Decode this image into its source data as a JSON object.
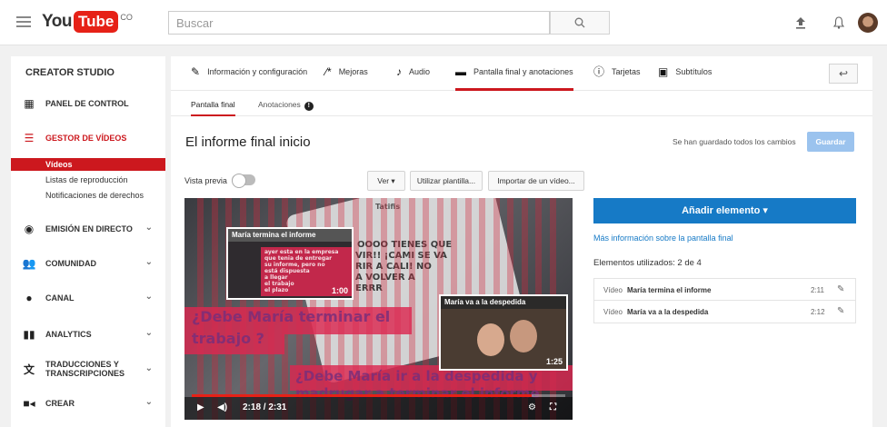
{
  "topbar": {
    "logo_you": "You",
    "logo_tube": "Tube",
    "logo_suffix": "CO",
    "search_placeholder": "Buscar"
  },
  "sidebar": {
    "title": "CREATOR STUDIO",
    "items": [
      {
        "label": "PANEL DE CONTROL",
        "icon": "dashboard-icon"
      },
      {
        "label": "GESTOR DE VÍDEOS",
        "icon": "video-manager-icon"
      },
      {
        "label": "EMISIÓN EN DIRECTO",
        "icon": "live-icon"
      },
      {
        "label": "COMUNIDAD",
        "icon": "community-icon"
      },
      {
        "label": "CANAL",
        "icon": "channel-icon"
      },
      {
        "label": "ANALYTICS",
        "icon": "analytics-icon"
      },
      {
        "label": "TRADUCCIONES Y",
        "label2": "TRANSCRIPCIONES",
        "icon": "translate-icon"
      },
      {
        "label": "CREAR",
        "icon": "create-icon"
      }
    ],
    "subitems": [
      "Vídeos",
      "Listas de reproducción",
      "Notificaciones de derechos"
    ]
  },
  "tabs": [
    "Información y configuración",
    "Mejoras",
    "Audio",
    "Pantalla final y anotaciones",
    "Tarjetas",
    "Subtítulos"
  ],
  "subtabs": [
    "Pantalla final",
    "Anotaciones"
  ],
  "video_title": "El informe final inicio",
  "saved_text": "Se han guardado todos los cambios",
  "save_label": "Guardar",
  "preview_label": "Vista previa",
  "toolbar": {
    "ver": "Ver",
    "template": "Utilizar plantilla...",
    "import": "Importar de un vídeo..."
  },
  "video": {
    "card1_title": "María termina el informe",
    "card1_duration": "1:00",
    "card2_title": "María va a la despedida",
    "card2_duration": "1:25",
    "banner1": "¿Debe María terminar el",
    "banner1b": "trabajo ?",
    "banner2": "¿Debe María ir a la despedida y",
    "banner2b": "madrugar a terminar el informe",
    "time": "2:18 / 2:31",
    "progress": 0.91,
    "phone_text": [
      "OOOO TIENES QUE",
      "VIR!! ¡CAMI SE VA",
      "RIR A CALI! NO",
      "A VOLVER A",
      "ERRR"
    ],
    "phone_name": "Tatifis",
    "card1_body": [
      "ayer esta en la empresa",
      "que tenia de entregar",
      "su informe, pero no",
      "está dispuesta",
      "a llegar",
      "el trabajo",
      "el plazo"
    ]
  },
  "add_element": "Añadir elemento",
  "more_info": "Más información sobre la pantalla final",
  "used_elements": "Elementos utilizados: 2 de 4",
  "elements": [
    {
      "type": "Vídeo",
      "name": "María termina el informe",
      "time": "2:11"
    },
    {
      "type": "Vídeo",
      "name": "María va a la despedida",
      "time": "2:12"
    }
  ],
  "colors": {
    "accent": "#cc181e",
    "blue": "#167ac6",
    "save_disabled": "#9bc3ee"
  }
}
